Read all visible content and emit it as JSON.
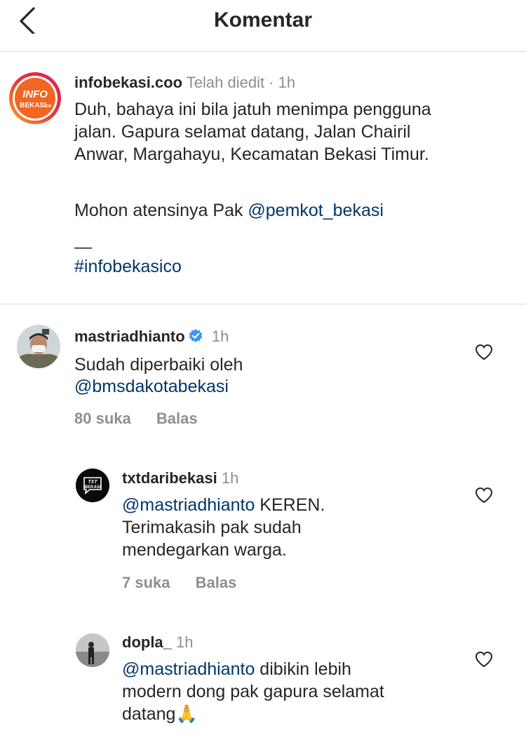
{
  "header": {
    "title": "Komentar"
  },
  "post": {
    "username": "infobekasi.coo",
    "edited": "Telah diedit",
    "time": "· 1h",
    "avatar_text_1": "INFO",
    "avatar_text_2": "BEKASI",
    "avatar_text_3": ".co",
    "line1": "Duh, bahaya ini bila jatuh menimpa pengguna",
    "line2": "jalan. Gapura selamat datang, Jalan Chairil",
    "line3": "Anwar, Margahayu, Kecamatan Bekasi Timur.",
    "line4_prefix": "Mohon atensinya Pak",
    "line4_mention": "@pemkot_bekasi",
    "dash": "—",
    "hashtag": "#infobekasico"
  },
  "comments": [
    {
      "username": "mastriadhianto",
      "verified": true,
      "time": "1h",
      "mention": "",
      "lines": [
        "Sudah diperbaiki oleh"
      ],
      "mention_line": "@bmsdakotabekasi",
      "likes": "80 suka",
      "reply": "Balas"
    },
    {
      "username": "txtdaribekasi",
      "time": "1h",
      "avatar_text_1": "TXT",
      "avatar_text_2": "BEKASI",
      "mention": "@mastriadhianto",
      "line1_rest": " KEREN.",
      "line2": "Terimakasih pak sudah",
      "line3": "mendegarkan warga.",
      "likes": "7 suka",
      "reply": "Balas"
    },
    {
      "username": "dopla_",
      "time": "1h",
      "mention": "@mastriadhianto",
      "line1_rest": " dibikin lebih",
      "line2": "modern dong pak gapura selamat",
      "line3": "datang🙏"
    }
  ],
  "colors": {
    "link": "#00376b",
    "muted": "#8e8e8e",
    "verified": "#3897f0",
    "divider": "#dbdbdb"
  }
}
